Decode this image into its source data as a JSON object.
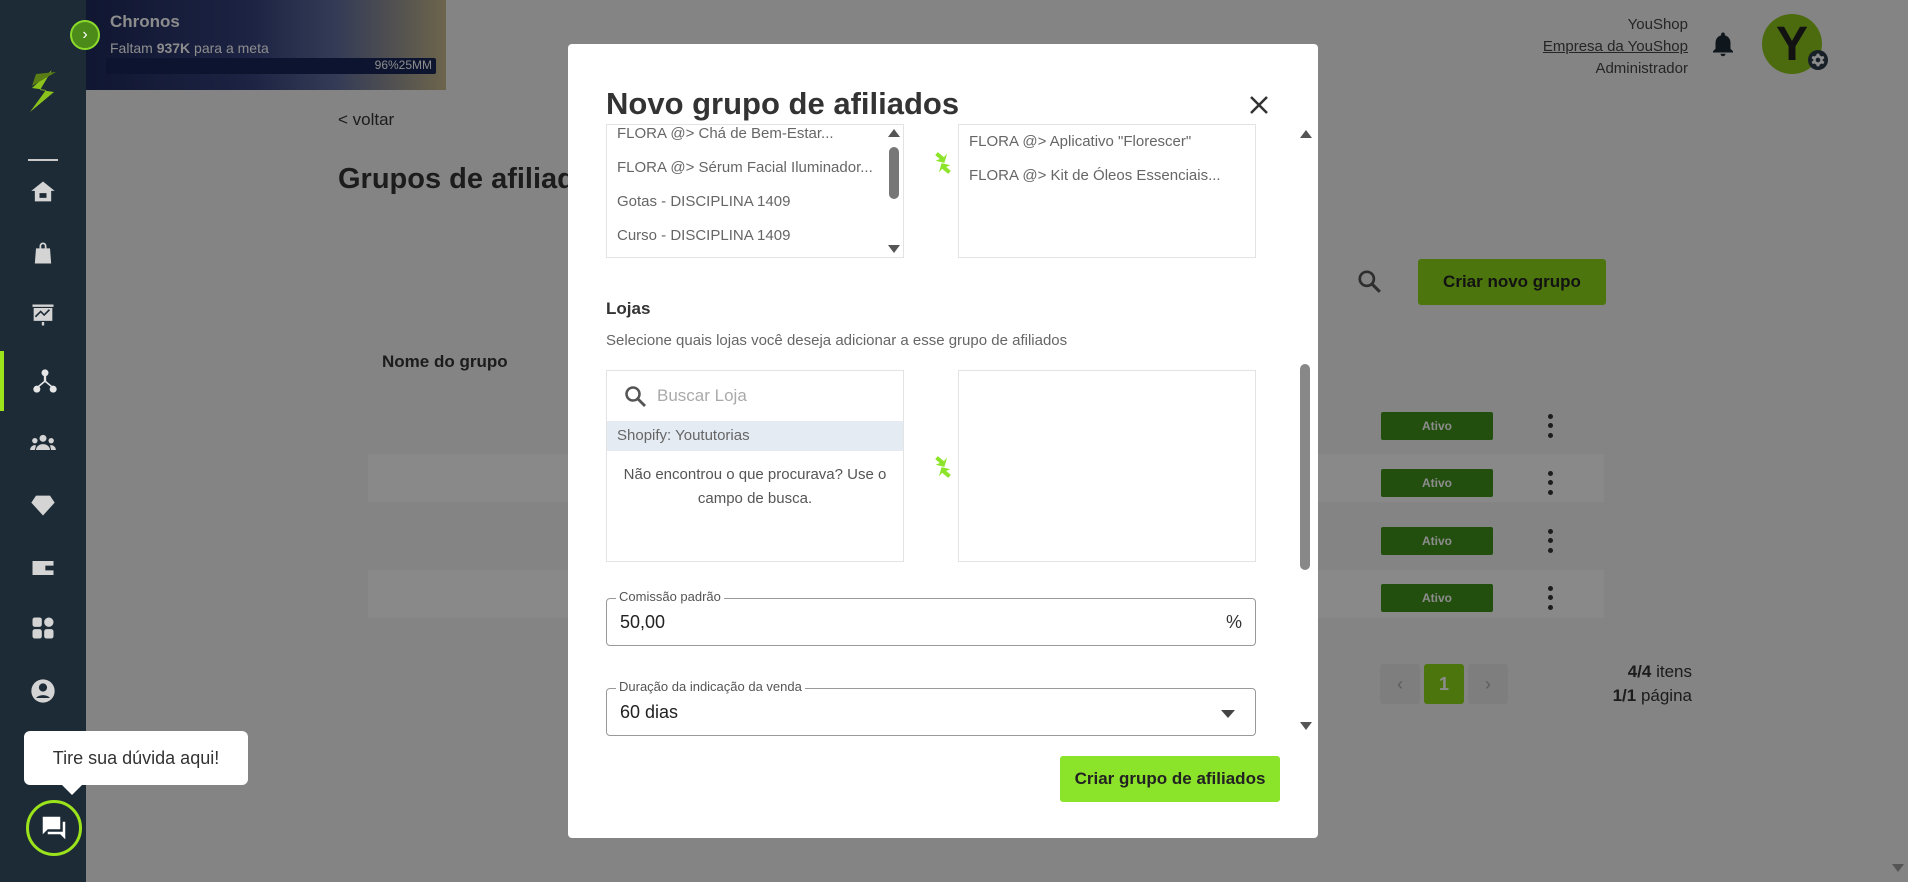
{
  "banner": {
    "name": "Chronos",
    "sub_prefix": "Faltam",
    "sub_amount": "937K",
    "sub_suffix": "para a meta",
    "progress_label": "96%25MM",
    "progress": 0.96
  },
  "header": {
    "company": "YouShop",
    "company_link": "Empresa da YouShop",
    "role": "Administrador",
    "avatar_letter": "Y"
  },
  "page": {
    "back_label": "< voltar",
    "title": "Grupos de afiliados",
    "create_button": "Criar novo grupo",
    "column_name": "Nome do grupo",
    "rows": [
      {
        "status": "Ativo"
      },
      {
        "status": "Ativo"
      },
      {
        "status": "Ativo"
      },
      {
        "status": "Ativo"
      }
    ],
    "pager": {
      "current": "1",
      "items_count": "4/4",
      "items_label": "itens",
      "pages_count": "1/1",
      "pages_label": "página"
    }
  },
  "help": {
    "bubble_text": "Tire sua dúvida aqui!"
  },
  "modal": {
    "title": "Novo grupo de afiliados",
    "products_available": [
      "FLORA @> Chá de Bem-Estar...",
      "FLORA @> Sérum Facial Iluminador...",
      "Gotas - DISCIPLINA 1409",
      "Curso - DISCIPLINA 1409"
    ],
    "products_selected": [
      "FLORA @> Aplicativo \"Florescer\"",
      "FLORA @> Kit de Óleos Essenciais..."
    ],
    "stores": {
      "label": "Lojas",
      "description": "Selecione quais lojas você deseja adicionar a esse grupo de afiliados",
      "search_placeholder": "Buscar Loja",
      "available": [
        "Shopify: Yoututorias"
      ],
      "empty_message": "Não encontrou o que procurava? Use o campo de busca."
    },
    "commission": {
      "label": "Comissão padrão",
      "value": "50,00",
      "suffix": "%"
    },
    "duration": {
      "label": "Duração da indicação da venda",
      "value": "60 dias"
    },
    "submit_label": "Criar grupo de afiliados"
  },
  "colors": {
    "accent": "#8be32a",
    "sidebar": "#1d2b36",
    "status_active": "#3f8f1a"
  }
}
